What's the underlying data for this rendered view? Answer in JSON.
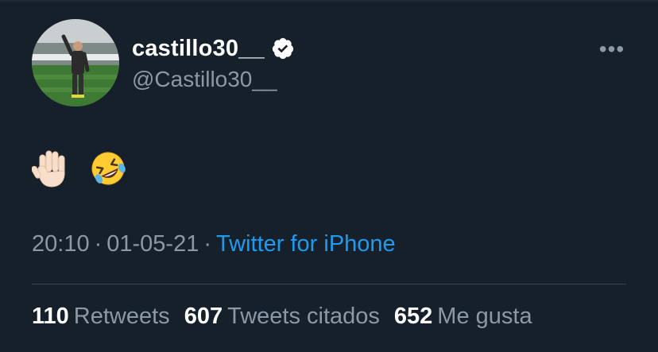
{
  "colors": {
    "background": "#16202b",
    "primary_text": "#ffffff",
    "secondary_text": "#8b98a5",
    "link": "#1d9bf0",
    "divider": "#38444d"
  },
  "tweet": {
    "display_name": "castillo30__",
    "handle": "@Castillo30__",
    "verified_icon": "verified-badge-icon",
    "more_icon": "more-horizontal-icon",
    "more_label": "•••",
    "emojis": [
      "raised-hand-emoji",
      "rolling-on-floor-laughing-emoji"
    ],
    "time": "20:10",
    "separator": "·",
    "date": "01-05-21",
    "source": "Twitter for iPhone"
  },
  "stats": [
    {
      "count": "110",
      "label": "Retweets"
    },
    {
      "count": "607",
      "label": "Tweets citados"
    },
    {
      "count": "652",
      "label": "Me gusta"
    }
  ]
}
